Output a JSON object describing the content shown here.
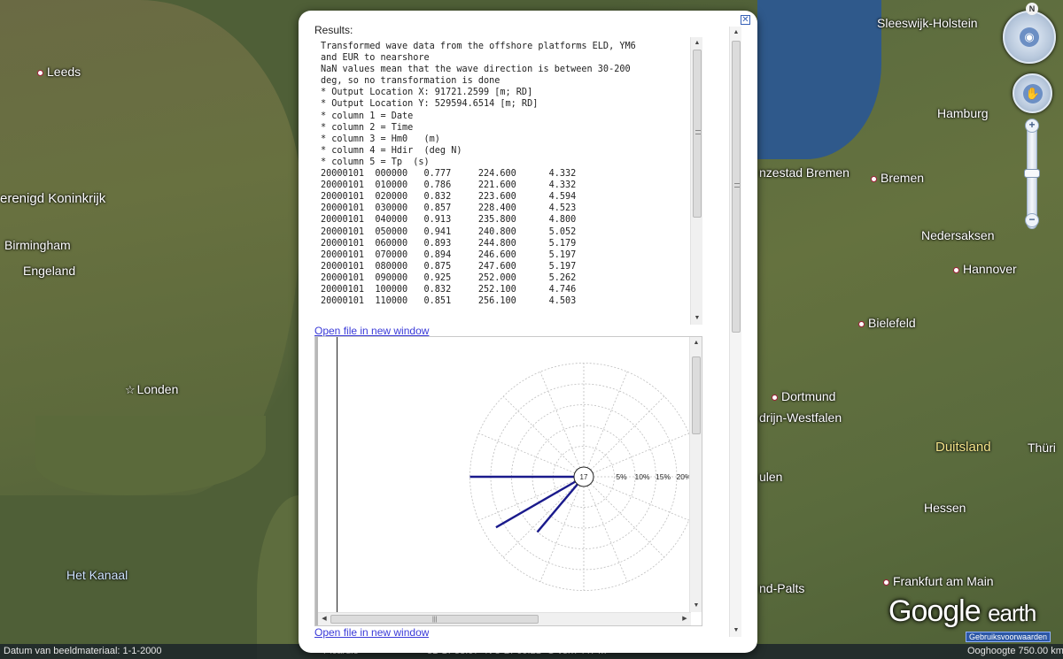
{
  "map": {
    "labels": [
      {
        "id": "leeds",
        "text": "Leeds",
        "kind": "city"
      },
      {
        "id": "koninkrijk",
        "text": "erenigd Koninkrijk",
        "kind": "region"
      },
      {
        "id": "birmingham",
        "text": "Birmingham",
        "kind": "plain"
      },
      {
        "id": "engeland",
        "text": "Engeland",
        "kind": "region"
      },
      {
        "id": "londen",
        "text": "Londen",
        "kind": "capital"
      },
      {
        "id": "kanaal",
        "text": "Het Kanaal",
        "kind": "sea"
      },
      {
        "id": "sleeswijk",
        "text": "Sleeswijk-Holstein",
        "kind": "plain"
      },
      {
        "id": "hamburg",
        "text": "Hamburg",
        "kind": "plain"
      },
      {
        "id": "bremenstad",
        "text": "nzestad Bremen",
        "kind": "plain"
      },
      {
        "id": "bremen",
        "text": "Bremen",
        "kind": "city"
      },
      {
        "id": "nedersaksen",
        "text": "Nedersaksen",
        "kind": "plain"
      },
      {
        "id": "hannover",
        "text": "Hannover",
        "kind": "city"
      },
      {
        "id": "bielefeld",
        "text": "Bielefeld",
        "kind": "city"
      },
      {
        "id": "dortmund",
        "text": "Dortmund",
        "kind": "city"
      },
      {
        "id": "westfalen",
        "text": "drijn-Westfalen",
        "kind": "plain"
      },
      {
        "id": "duitsland",
        "text": "Duitsland",
        "kind": "country"
      },
      {
        "id": "thur",
        "text": "Thüri",
        "kind": "plain"
      },
      {
        "id": "ulen",
        "text": "ulen",
        "kind": "plain"
      },
      {
        "id": "hessen",
        "text": "Hessen",
        "kind": "plain"
      },
      {
        "id": "palts",
        "text": "nd-Palts",
        "kind": "plain"
      },
      {
        "id": "frankfurt",
        "text": "Frankfurt am Main",
        "kind": "city"
      }
    ],
    "logo_google": "Google",
    "logo_earth": "earth",
    "terms_link": "Gebruiksvoorwaarden",
    "compass_n": "N"
  },
  "statusbar": {
    "imagery_date": "Datum van beeldmateriaal: 1-1-2000",
    "place": "Picardie",
    "coords": "51°17'58.07\" N   8°27'00.21\" O  vern   447 m",
    "eye_alt": "Ooghoogte  750.00 km"
  },
  "balloon": {
    "close_icon": "✕",
    "results_label": "Results:",
    "text_lines": [
      "Transformed wave data from the offshore platforms ELD, YM6",
      "and EUR to nearshore",
      "NaN values mean that the wave direction is between 30-200",
      "deg, so no transformation is done",
      "* Output Location X: 91721.2599 [m; RD]",
      "* Output Location Y: 529594.6514 [m; RD]",
      "* column 1 = Date",
      "* column 2 = Time",
      "* column 3 = Hm0   (m)",
      "* column 4 = Hdir  (deg N)",
      "* column 5 = Tp  (s)",
      "20000101  000000   0.777     224.600      4.332",
      "20000101  010000   0.786     221.600      4.332",
      "20000101  020000   0.832     223.600      4.594",
      "20000101  030000   0.857     228.400      4.523",
      "20000101  040000   0.913     235.800      4.800",
      "20000101  050000   0.941     240.800      5.052",
      "20000101  060000   0.893     244.800      5.179",
      "20000101  070000   0.894     246.600      5.197",
      "20000101  080000   0.875     247.600      5.197",
      "20000101  090000   0.925     252.000      5.262",
      "20000101  100000   0.832     252.100      4.746",
      "20000101  110000   0.851     256.100      4.503"
    ],
    "open_link_1": "Open file in new window",
    "open_link_2": "Open file in new window"
  },
  "chart_data": {
    "type": "wind-rose",
    "calm_label": "17",
    "ring_labels": [
      "5%",
      "10%",
      "15%",
      "20%"
    ],
    "ring_percent": [
      5,
      10,
      15,
      20,
      25
    ],
    "sector_count": 16,
    "spokes": [
      {
        "direction_deg": 270,
        "percent": 25
      },
      {
        "direction_deg": 240,
        "percent": 22
      },
      {
        "direction_deg": 220,
        "percent": 15
      }
    ],
    "line_color": "#1a1a8c",
    "grid_color": "#bdbdbd"
  }
}
